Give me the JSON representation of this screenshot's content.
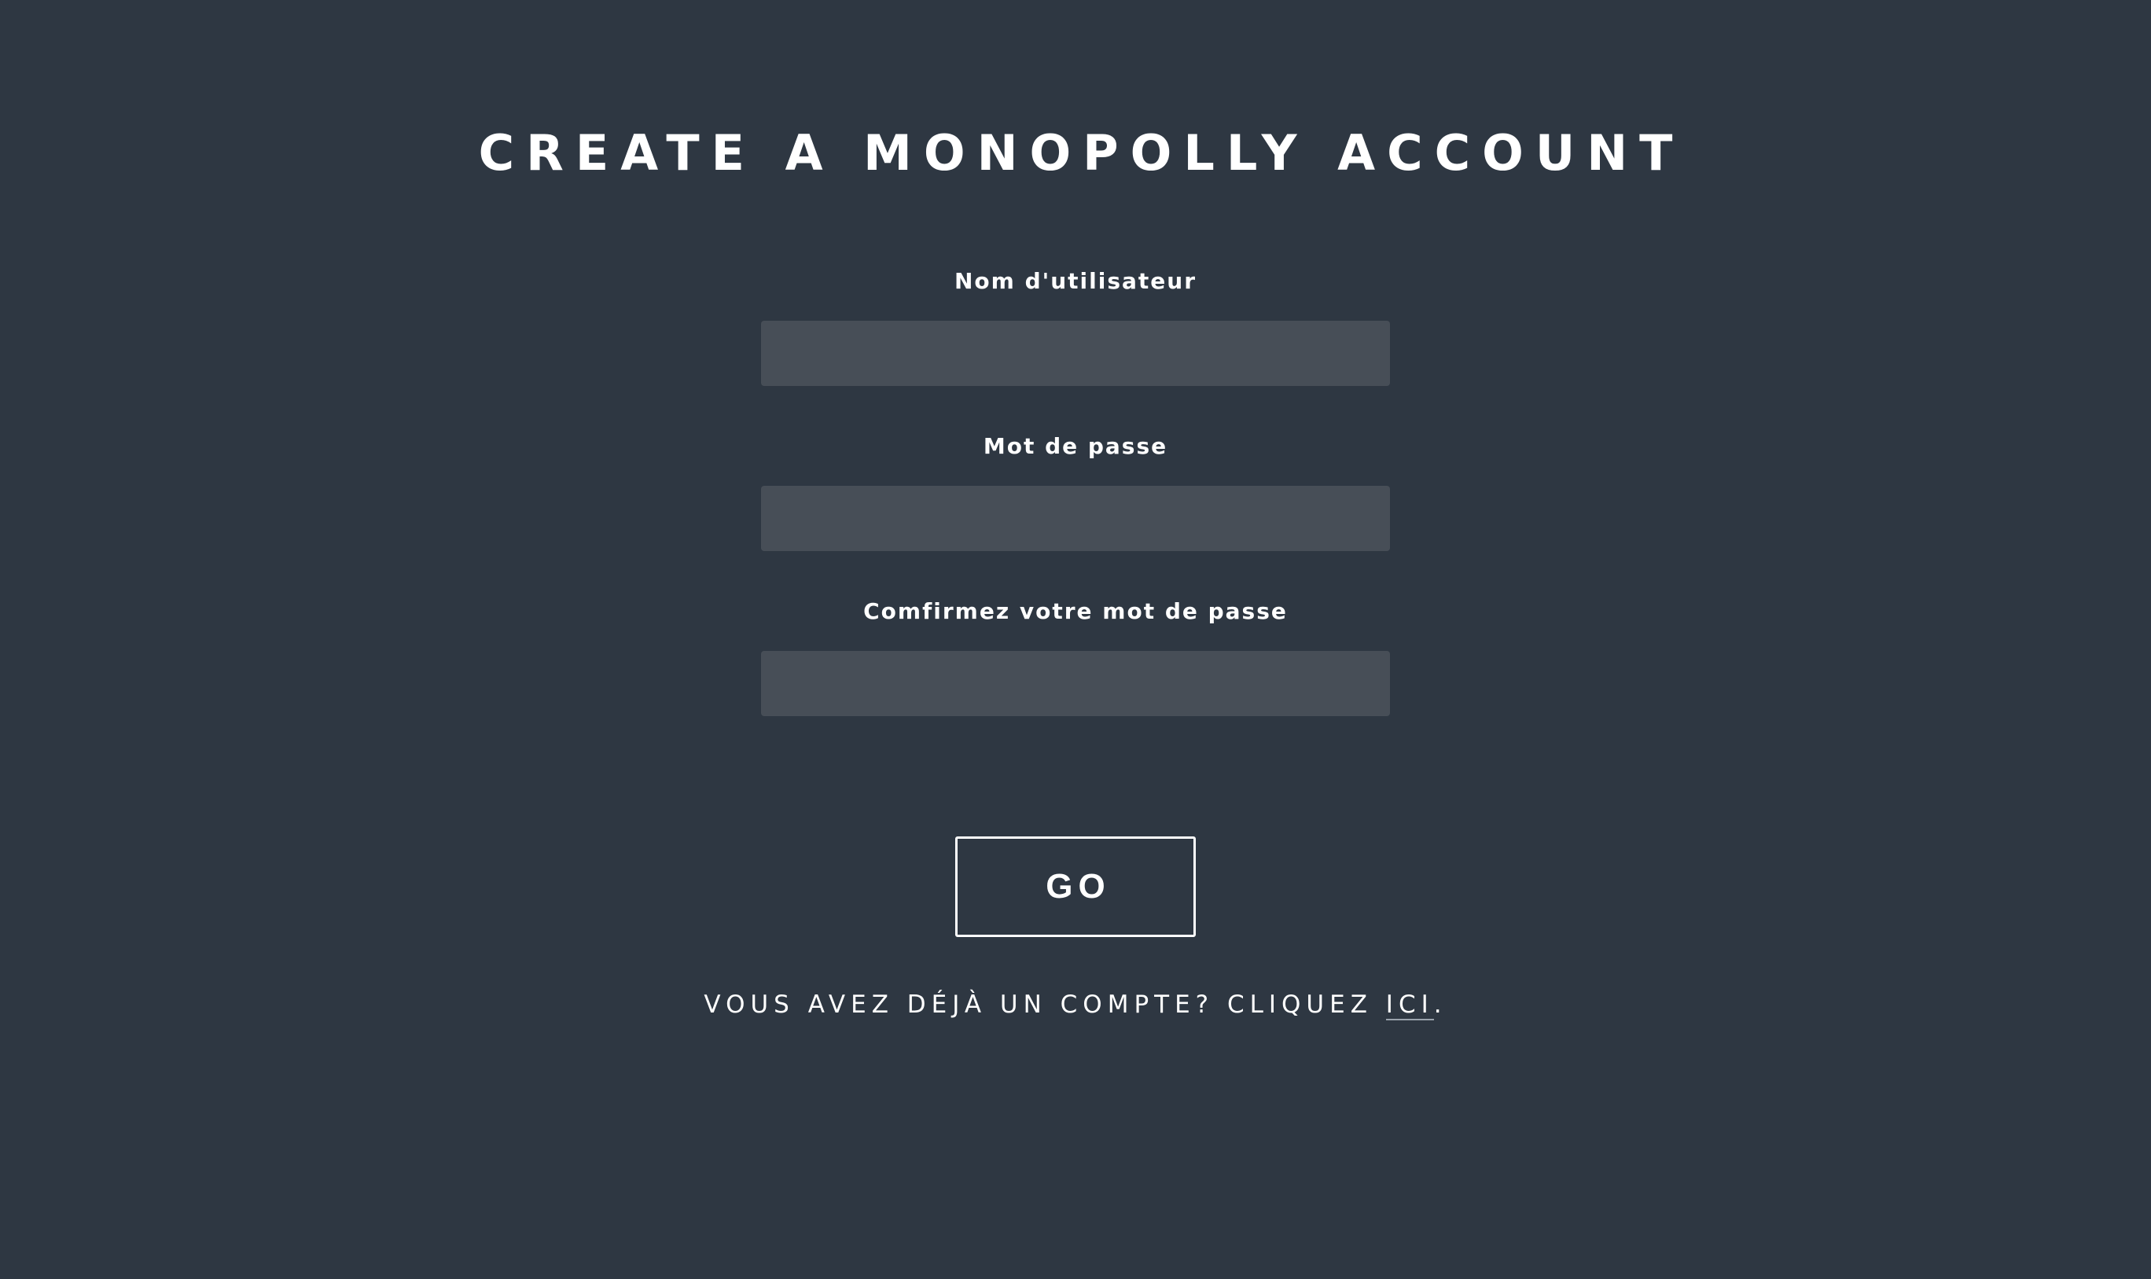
{
  "page": {
    "title": "CREATE A MONOPOLLY ACCOUNT"
  },
  "form": {
    "username": {
      "label": "Nom d'utilisateur",
      "value": "",
      "placeholder": ""
    },
    "password": {
      "label": "Mot de passe",
      "value": "",
      "placeholder": ""
    },
    "confirm_password": {
      "label": "Comfirmez votre mot de passe",
      "value": "",
      "placeholder": ""
    },
    "submit_label": "GO"
  },
  "footer": {
    "text": "VOUS AVEZ DÉJÀ UN COMPTE? CLIQUEZ ",
    "link_label": "ICI",
    "suffix": "."
  },
  "colors": {
    "background": "#2e3742",
    "input_background": "#474e57",
    "text": "#ffffff"
  }
}
